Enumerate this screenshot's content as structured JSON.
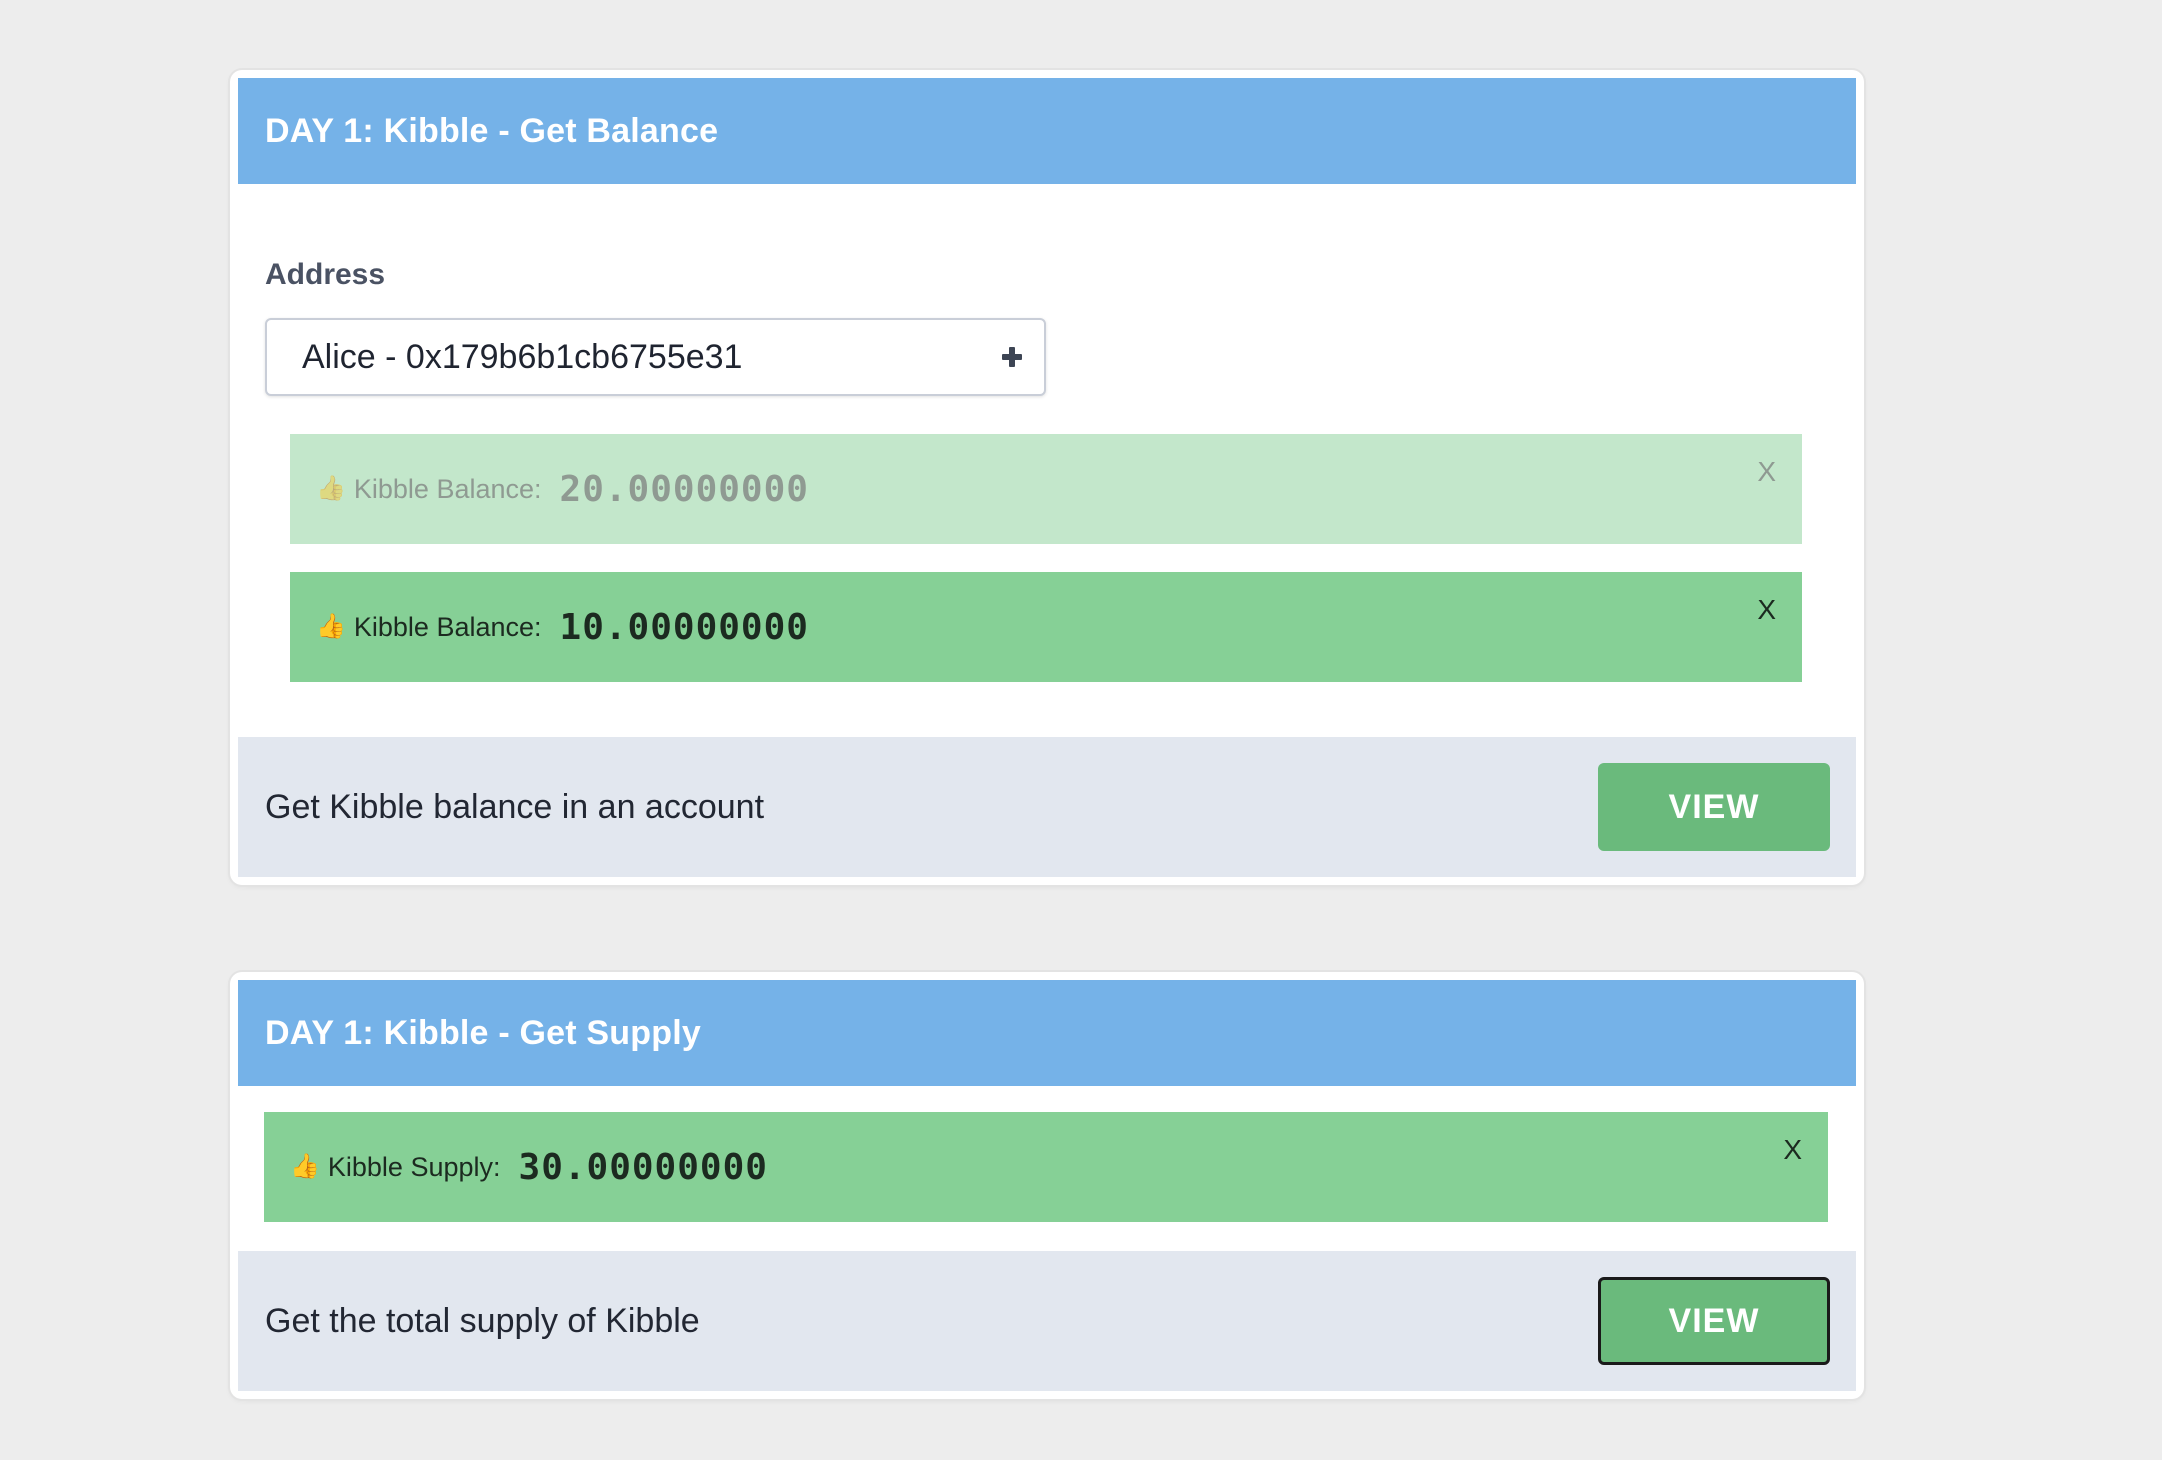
{
  "balance_card": {
    "title": "DAY 1: Kibble - Get Balance",
    "address_label": "Address",
    "address_value": "Alice - 0x179b6b1cb6755e31",
    "results": [
      {
        "icon": "👍",
        "label": "Kibble Balance:",
        "value": "20.00000000",
        "close": "X",
        "state": "faded"
      },
      {
        "icon": "👍",
        "label": "Kibble Balance:",
        "value": "10.00000000",
        "close": "X",
        "state": "active"
      }
    ],
    "description": "Get Kibble balance in an account",
    "button_label": "VIEW"
  },
  "supply_card": {
    "title": "DAY 1: Kibble - Get Supply",
    "result": {
      "icon": "👍",
      "label": "Kibble Supply:",
      "value": "30.00000000",
      "close": "X",
      "state": "active"
    },
    "description": "Get the total supply of Kibble",
    "button_label": "VIEW"
  },
  "colors": {
    "header": "#75b2e8",
    "result_active": "#86d096",
    "result_faded": "#c3e7cb",
    "footer": "#e2e7ef",
    "button": "#6aba7c"
  }
}
